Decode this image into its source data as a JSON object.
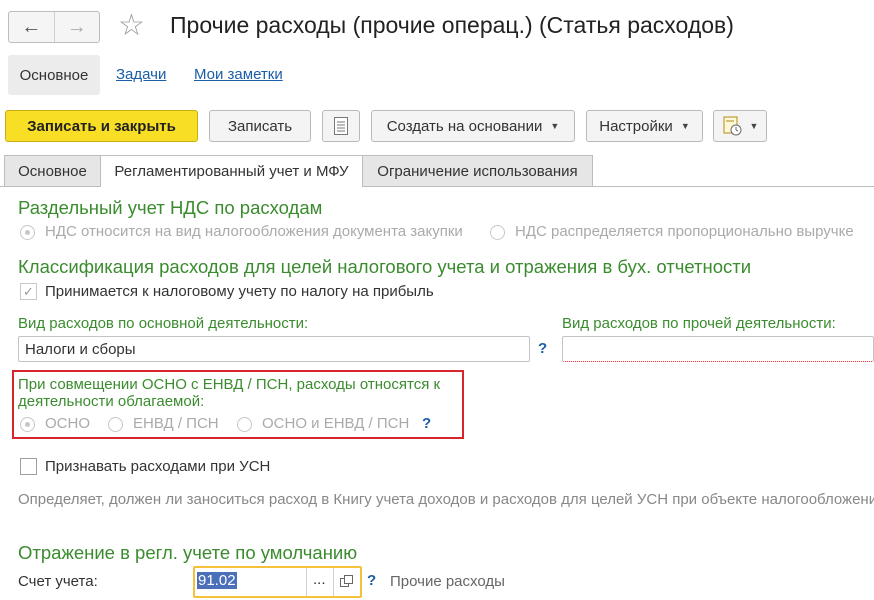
{
  "window": {
    "title": "Прочие расходы (прочие операц.) (Статья расходов)",
    "back_icon": "arrow-left",
    "forward_icon": "arrow-right",
    "favorite_icon": "star"
  },
  "page_links": {
    "main": "Основное",
    "tasks": "Задачи",
    "notes": "Мои заметки"
  },
  "toolbar": {
    "save_close": "Записать и закрыть",
    "save": "Записать",
    "list_icon": "list",
    "create_based": "Создать на основании",
    "settings": "Настройки",
    "report_icon": "report"
  },
  "tabs": [
    "Основное",
    "Регламентированный учет и МФУ",
    "Ограничение использования"
  ],
  "vat": {
    "heading": "Раздельный учет НДС по расходам",
    "option1": "НДС относится на вид налогообложения документа закупки",
    "option2": "НДС распределяется пропорционально выручке"
  },
  "classification": {
    "heading": "Классификация расходов для целей налогового учета и отражения в бух. отчетности",
    "profit_tax_checkbox": "Принимается к налоговому учету по налогу на прибыль",
    "main_activity_label": "Вид расходов по основной деятельности:",
    "main_activity_value": "Налоги и сборы",
    "other_activity_label": "Вид расходов по прочей деятельности:",
    "help": "?"
  },
  "regime": {
    "label": "При совмещении ОСНО с ЕНВД / ПСН, расходы относятся к деятельности облагаемой:",
    "options": [
      "ОСНО",
      "ЕНВД / ПСН",
      "ОСНО и ЕНВД / ПСН"
    ],
    "help": "?"
  },
  "usn": {
    "checkbox": "Признавать расходами при УСН",
    "hint": "Определяет, должен ли заноситься расход в Книгу учета доходов и расходов для целей УСН при объекте налогообложения"
  },
  "reflection": {
    "heading": "Отражение в регл. учете по умолчанию",
    "account_label": "Счет учета:",
    "account_value": "91.02",
    "ellipsis": "...",
    "open_icon": "open-window",
    "help": "?",
    "account_name": "Прочие расходы"
  }
}
